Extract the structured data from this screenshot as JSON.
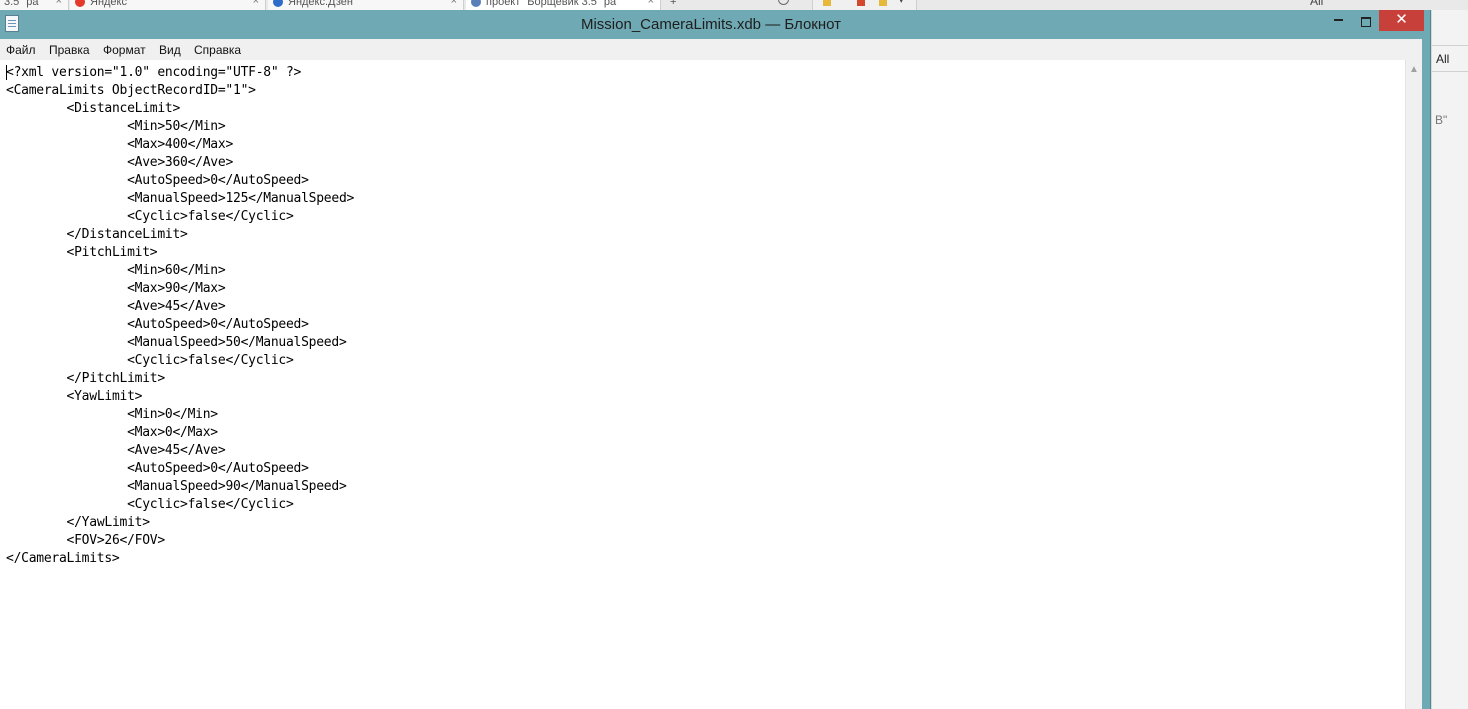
{
  "background": {
    "tabs": [
      {
        "label": "3.5\" ра",
        "favicon_color": ""
      },
      {
        "label": "Яндекс",
        "favicon_color": "#e53a2b"
      },
      {
        "label": "Яндекс.Дзен",
        "favicon_color": "#2d6bc8"
      },
      {
        "label": "проект \"Борщевик 3.5\" ра",
        "favicon_color": "#5a7fb8"
      }
    ],
    "new_tab_label": "+",
    "top_right_text": "All",
    "side_all_text": "All",
    "side_quote_text": "B\""
  },
  "window": {
    "title": "Mission_CameraLimits.xdb — Блокнот",
    "close_symbol": "✕",
    "colors": {
      "frame": "#6fa9b3",
      "close_button": "#c7413a"
    }
  },
  "menu": [
    "Файл",
    "Правка",
    "Формат",
    "Вид",
    "Справка"
  ],
  "document": {
    "text": "<?xml version=\"1.0\" encoding=\"UTF-8\" ?>\n<CameraLimits ObjectRecordID=\"1\">\n\t<DistanceLimit>\n\t\t<Min>50</Min>\n\t\t<Max>400</Max>\n\t\t<Ave>360</Ave>\n\t\t<AutoSpeed>0</AutoSpeed>\n\t\t<ManualSpeed>125</ManualSpeed>\n\t\t<Cyclic>false</Cyclic>\n\t</DistanceLimit>\n\t<PitchLimit>\n\t\t<Min>60</Min>\n\t\t<Max>90</Max>\n\t\t<Ave>45</Ave>\n\t\t<AutoSpeed>0</AutoSpeed>\n\t\t<ManualSpeed>50</ManualSpeed>\n\t\t<Cyclic>false</Cyclic>\n\t</PitchLimit>\n\t<YawLimit>\n\t\t<Min>0</Min>\n\t\t<Max>0</Max>\n\t\t<Ave>45</Ave>\n\t\t<AutoSpeed>0</AutoSpeed>\n\t\t<ManualSpeed>90</ManualSpeed>\n\t\t<Cyclic>false</Cyclic>\n\t</YawLimit>\n\t<FOV>26</FOV>\n</CameraLimits>"
  },
  "scrollbar": {
    "up_arrow": "▲"
  }
}
